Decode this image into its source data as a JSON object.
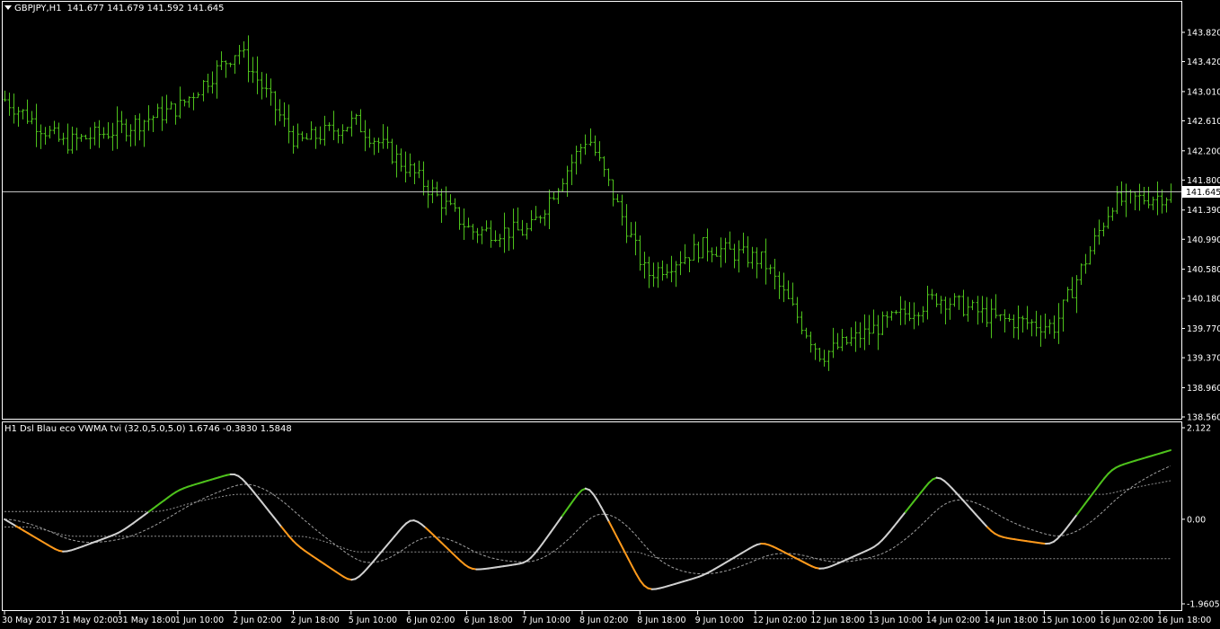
{
  "main": {
    "symbol_tf": "GBPJPY,H1",
    "ohlc": "141.677 141.679 141.592 141.645",
    "current_price": "141.645",
    "price_ticks": [
      "143.820",
      "143.420",
      "143.010",
      "142.610",
      "142.200",
      "141.800",
      "141.390",
      "140.990",
      "140.580",
      "140.180",
      "139.770",
      "139.370",
      "138.960",
      "138.560"
    ],
    "price_range": [
      138.56,
      143.82
    ]
  },
  "indicator": {
    "caption": "H1 Dsl Blau eco VWMA tvi (32.0,5.0,5.0) 1.6746 -0.3830 1.5848",
    "ticks": [
      "2.122",
      "0.00",
      "-1.9605"
    ],
    "range": [
      -1.9605,
      2.122
    ]
  },
  "time_labels": [
    "30 May 2017",
    "31 May 02:00",
    "31 May 18:00",
    "1 Jun 10:00",
    "2 Jun 02:00",
    "2 Jun 18:00",
    "5 Jun 10:00",
    "6 Jun 02:00",
    "6 Jun 18:00",
    "7 Jun 10:00",
    "8 Jun 02:00",
    "8 Jun 18:00",
    "9 Jun 10:00",
    "12 Jun 02:00",
    "12 Jun 18:00",
    "13 Jun 10:00",
    "14 Jun 02:00",
    "14 Jun 18:00",
    "15 Jun 10:00",
    "16 Jun 02:00",
    "16 Jun 18:00"
  ],
  "colors": {
    "background": "#000000",
    "frame": "#ffffff",
    "bars": "#4ec21c",
    "price_line": "#c0c0c0",
    "osc_up": "#4ec21c",
    "osc_down": "#ff9a1c",
    "osc_neutral": "#d0d0d0",
    "signal": "#a0a0a0",
    "levels": "#909090"
  },
  "chart_data": [
    {
      "type": "line",
      "title": "GBPJPY,H1",
      "x": [
        "30 May 2017",
        "31 May 02:00",
        "31 May 18:00",
        "1 Jun 10:00",
        "2 Jun 02:00",
        "2 Jun 18:00",
        "5 Jun 10:00",
        "6 Jun 02:00",
        "6 Jun 18:00",
        "7 Jun 10:00",
        "8 Jun 02:00",
        "8 Jun 18:00",
        "9 Jun 10:00",
        "12 Jun 02:00",
        "12 Jun 18:00",
        "13 Jun 10:00",
        "14 Jun 02:00",
        "14 Jun 18:00",
        "15 Jun 10:00",
        "16 Jun 02:00",
        "16 Jun 18:00"
      ],
      "y": [
        142.9,
        142.3,
        142.5,
        142.8,
        143.6,
        142.3,
        142.6,
        141.9,
        141.1,
        141.1,
        142.4,
        140.5,
        140.9,
        140.7,
        139.4,
        139.8,
        140.2,
        139.9,
        139.8,
        141.5,
        141.6
      ],
      "ylim": [
        138.56,
        143.82
      ]
    },
    {
      "type": "line",
      "title": "H1 Dsl Blau eco VWMA tvi (32.0,5.0,5.0)",
      "x": [
        "30 May 2017",
        "31 May 02:00",
        "31 May 18:00",
        "1 Jun 10:00",
        "2 Jun 02:00",
        "2 Jun 18:00",
        "5 Jun 10:00",
        "6 Jun 02:00",
        "6 Jun 18:00",
        "7 Jun 10:00",
        "8 Jun 02:00",
        "8 Jun 18:00",
        "9 Jun 10:00",
        "12 Jun 02:00",
        "12 Jun 18:00",
        "13 Jun 10:00",
        "14 Jun 02:00",
        "14 Jun 18:00",
        "15 Jun 10:00",
        "16 Jun 02:00",
        "16 Jun 18:00"
      ],
      "y": [
        0.0,
        -0.8,
        -0.3,
        0.7,
        1.1,
        -0.6,
        -1.5,
        0.1,
        -1.2,
        -1.0,
        0.9,
        -1.7,
        -1.3,
        -0.5,
        -1.2,
        -0.6,
        1.1,
        -0.4,
        -0.6,
        1.2,
        1.6
      ],
      "ylim": [
        -1.9605,
        2.122
      ]
    }
  ]
}
